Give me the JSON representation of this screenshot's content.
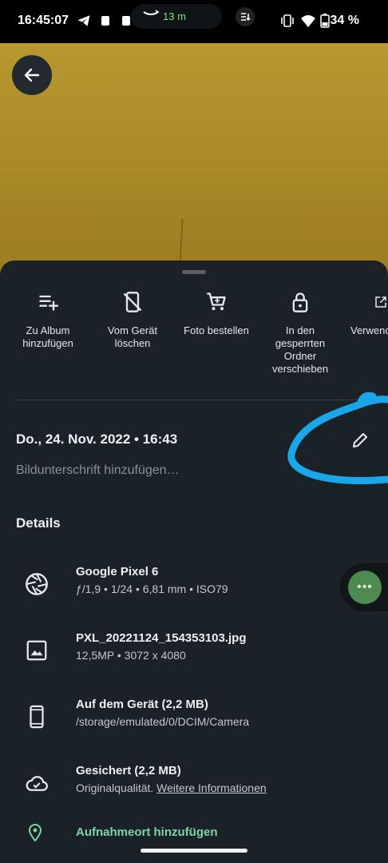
{
  "status": {
    "time": "16:45:07",
    "nav_distance": "13 m",
    "battery": "34 %"
  },
  "actions": [
    {
      "label": "Zu Album hinzufügen",
      "icon": "playlist-add-icon"
    },
    {
      "label": "Vom Gerät löschen",
      "icon": "phone-delete-icon"
    },
    {
      "label": "Foto bestellen",
      "icon": "cart-icon"
    },
    {
      "label": "In den gesperrten Ordner verschieben",
      "icon": "lock-icon"
    },
    {
      "label": "Verwend",
      "icon": "open-external-icon"
    }
  ],
  "info": {
    "date": "Do., 24. Nov. 2022 • 16:43",
    "caption_placeholder": "Bildunterschrift hinzufügen…"
  },
  "details": {
    "heading": "Details",
    "camera": {
      "title": "Google Pixel 6",
      "sub": "ƒ/1,9  •  1/24  •  6,81 mm  •  ISO79"
    },
    "file": {
      "title": "PXL_20221124_154353103.jpg",
      "sub": "12,5MP  •  3072 x 4080"
    },
    "device": {
      "title": "Auf dem Gerät (2,2 MB)",
      "sub": "/storage/emulated/0/DCIM/Camera"
    },
    "backup": {
      "title": "Gesichert (2,2 MB)",
      "sub": "Originalqualität.",
      "link": "Weitere Informationen"
    },
    "location": "Aufnahmeort hinzufügen"
  },
  "fab_label": "•••",
  "colors": {
    "accent_green": "#7fd3a6",
    "annotation_blue": "#1aa7ea",
    "background": "#1a2127"
  }
}
